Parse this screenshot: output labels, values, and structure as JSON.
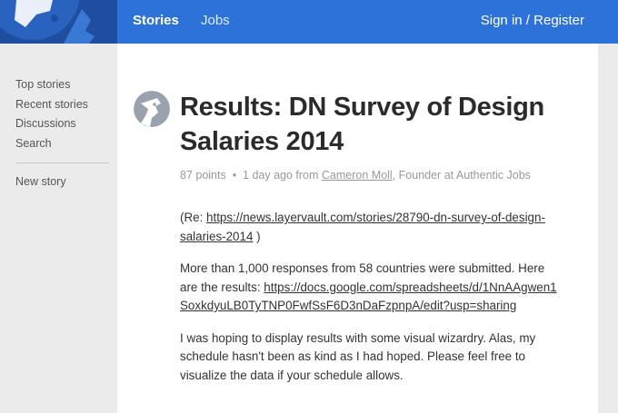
{
  "header": {
    "tabs": [
      {
        "label": "Stories",
        "active": true
      },
      {
        "label": "Jobs",
        "active": false
      }
    ],
    "auth": {
      "signin": "Sign in",
      "separator": " / ",
      "register": "Register"
    }
  },
  "sidebar": {
    "items": [
      "Top stories",
      "Recent stories",
      "Discussions",
      "Search"
    ],
    "secondary": [
      "New story"
    ]
  },
  "story": {
    "title": "Results: DN Survey of Design Salaries 2014",
    "points": "87 points",
    "bullet": "•",
    "time": "1 day ago from",
    "author": "Cameron Moll",
    "author_role": ", Founder at Authentic Jobs",
    "p1_prefix": "(Re: ",
    "p1_link": "https://news.layervault.com/stories/28790-dn-survey-of-design-salaries-2014",
    "p1_suffix": " )",
    "p2_text": "More than 1,000 responses from 58 countries were submitted. Here are the results: ",
    "p2_link": "https://docs.google.com/spreadsheets/d/1NnAAgwen1SoxkdyuLB0TyTNP0FwfSsF6D3nDaFzpnpA/edit?usp=sharing",
    "p3_text": "I was hoping to display results with some visual wizardry. Alas, my schedule hasn't been as kind as I had hoped. Please feel free to visualize the data if your schedule allows."
  },
  "colors": {
    "header_bg": "#2d72d9",
    "logo_bg": "#1f4ea0",
    "sidebar_bg": "#ebebeb",
    "text": "#2b2b2b",
    "meta": "#999999"
  }
}
